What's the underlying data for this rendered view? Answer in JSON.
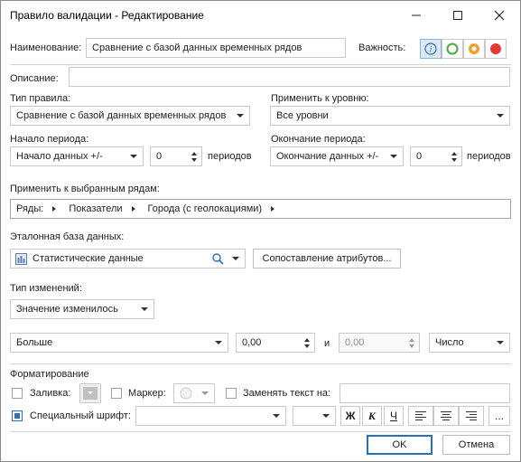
{
  "window": {
    "title": "Правило валидации - Редактирование"
  },
  "name": {
    "label": "Наименование:",
    "value": "Сравнение с базой данных временных рядов"
  },
  "importance": {
    "label": "Важность:"
  },
  "description": {
    "label": "Описание:",
    "value": ""
  },
  "rule_type": {
    "label": "Тип правила:",
    "value": "Сравнение с базой данных временных рядов"
  },
  "apply_level": {
    "label": "Применить к уровню:",
    "value": "Все уровни"
  },
  "period_start": {
    "label": "Начало периода:",
    "value": "Начало данных +/-",
    "count": "0",
    "unit": "периодов"
  },
  "period_end": {
    "label": "Окончание периода:",
    "value": "Окончание данных +/-",
    "count": "0",
    "unit": "периодов"
  },
  "apply_rows": {
    "label": "Применить к выбранным рядам:",
    "crumbs": [
      "Ряды:",
      "Показатели",
      "Города (с геолокациями)"
    ]
  },
  "ref_db": {
    "label": "Эталонная база данных:",
    "value": "Статистические данные",
    "match_button": "Сопоставление атрибутов..."
  },
  "change_type": {
    "label": "Тип изменений:",
    "value": "Значение изменилось"
  },
  "condition": {
    "operator": "Больше",
    "value1": "0,00",
    "and_label": "и",
    "value2": "0,00",
    "unit": "Число"
  },
  "formatting": {
    "label": "Форматирование",
    "fill_label": "Заливка:",
    "marker_label": "Маркер:",
    "replace_label": "Заменять текст на:",
    "replace_value": "",
    "font_label": "Специальный шрифт:",
    "font_name": "",
    "font_size": "",
    "bold": "Ж",
    "italic": "К",
    "underline": "Ч",
    "more": "..."
  },
  "footer": {
    "ok": "OK",
    "cancel": "Отмена"
  },
  "colors": {
    "accent": "#2d6fb9",
    "green": "#4aa84a",
    "orange": "#f0a030",
    "red": "#e53935"
  }
}
